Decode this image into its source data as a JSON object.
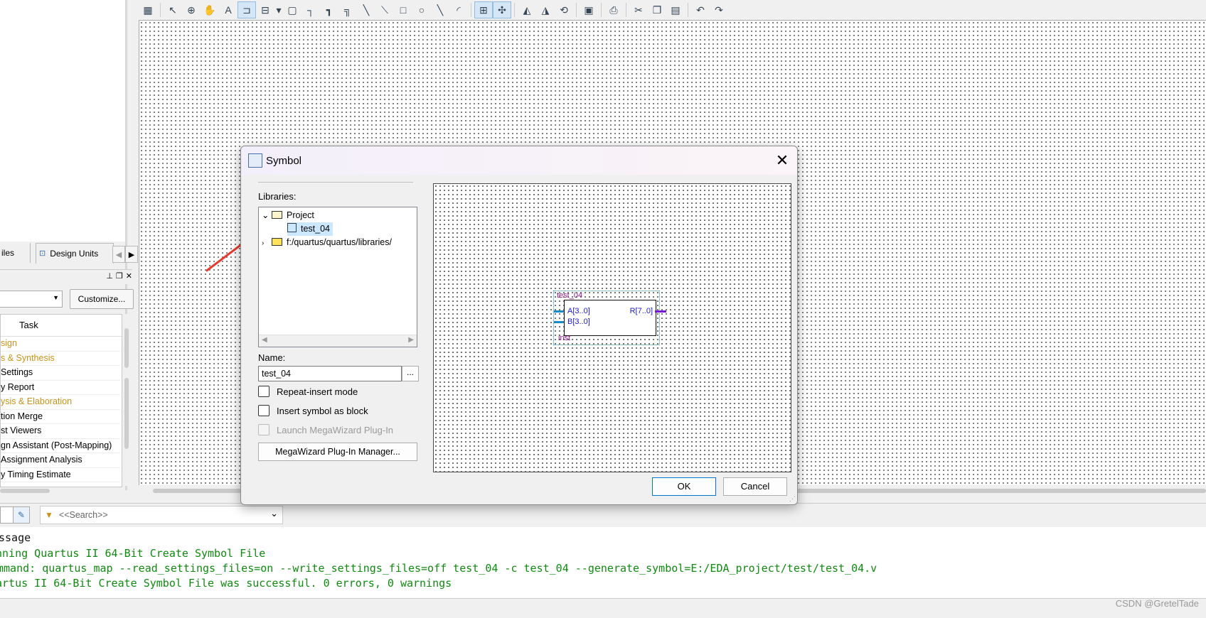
{
  "left_panel": {
    "tabs": [
      "iles",
      "Design Units"
    ],
    "customize_label": "Customize...",
    "task_header": "Task",
    "tasks": [
      {
        "label": "sign",
        "color": "#c8921a"
      },
      {
        "label": "s & Synthesis",
        "color": "#c8921a"
      },
      {
        "label": "Settings",
        "color": "#000000"
      },
      {
        "label": "y Report",
        "color": "#000000"
      },
      {
        "label": "ysis & Elaboration",
        "color": "#c8921a"
      },
      {
        "label": "tion Merge",
        "color": "#000000"
      },
      {
        "label": "st Viewers",
        "color": "#000000"
      },
      {
        "label": "gn Assistant (Post-Mapping)",
        "color": "#000000"
      },
      {
        "label": "Assignment Analysis",
        "color": "#000000"
      },
      {
        "label": "y Timing Estimate",
        "color": "#000000"
      }
    ]
  },
  "toolbar_icons": [
    "block-insert-icon",
    "pointer-icon",
    "zoom-icon",
    "hand-icon",
    "text-icon",
    "symbol-tool-icon",
    "pin-tool-icon",
    "dropdown-icon",
    "block-tool-icon",
    "orthogonal-node-icon",
    "orthogonal-bus-icon",
    "orthogonal-conduit-icon",
    "diagonal-node-icon",
    "diagonal-bus-icon",
    "rectangle-icon",
    "ellipse-icon",
    "line-icon",
    "arc-icon",
    "rubberbanding-icon",
    "partial-line-select-icon",
    "flip-horizontal-icon",
    "flip-vertical-icon",
    "rotate-icon",
    "save-icon",
    "print-icon",
    "cut-icon",
    "copy-icon",
    "paste-icon",
    "undo-icon",
    "redo-icon"
  ],
  "search": {
    "placeholder": "<<Search>>"
  },
  "messages": {
    "header": "ssage",
    "lines": [
      "nning Quartus II 64-Bit Create Symbol File",
      "mmand: quartus_map --read_settings_files=on --write_settings_files=off test_04 -c test_04 --generate_symbol=E:/EDA_project/test/test_04.v",
      "artus II 64-Bit Create Symbol File was successful. 0 errors, 0 warnings"
    ]
  },
  "watermark": "CSDN @GretelTade",
  "dialog": {
    "title": "Symbol",
    "libraries_label": "Libraries:",
    "tree": {
      "project": "Project",
      "child": "test_04",
      "library": "f:/quartus/quartus/libraries/"
    },
    "name_label": "Name:",
    "name_value": "test_04",
    "browse_label": "...",
    "repeat_insert": "Repeat-insert mode",
    "insert_block": "Insert symbol as block",
    "launch_mega": "Launch MegaWizard Plug-In",
    "mega_manager": "MegaWizard Plug-In Manager...",
    "ok": "OK",
    "cancel": "Cancel",
    "symbol": {
      "name": "test_04",
      "inst": "inst",
      "pin_a": "A[3..0]",
      "pin_b": "B[3..0]",
      "pin_r": "R[7..0]"
    }
  },
  "colors": {
    "arrow": "#e53c30",
    "warning_text": "#c8921a",
    "message_green": "#108a10",
    "symbol_text": "#1a1ad0",
    "symbol_name": "#8a1a8a"
  }
}
